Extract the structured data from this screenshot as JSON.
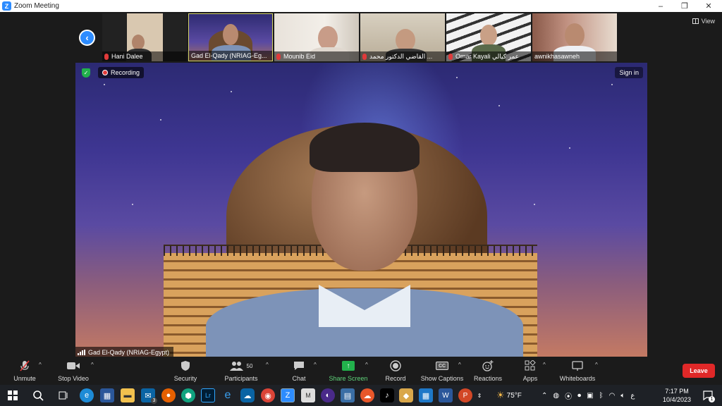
{
  "window": {
    "title": "Zoom Meeting",
    "minimize": "–",
    "restore": "❐",
    "close": "✕"
  },
  "meeting": {
    "view_label": "View",
    "nav_prev": "‹",
    "participants_strip": [
      {
        "name": "Hani Dalee",
        "muted": true
      },
      {
        "name": "Gad El-Qady (NRIAG-Eg...",
        "muted": false
      },
      {
        "name": "Mounib Eid",
        "muted": true
      },
      {
        "name": "القاضي الدكتور محمد ...",
        "muted": true
      },
      {
        "name": "Omar Kayali  عمر كيالي",
        "muted": true
      },
      {
        "name": "awnikhasawneh",
        "muted": false
      }
    ],
    "recording_label": "Recording",
    "signin_label": "Sign in",
    "active_speaker_name": "Gad El-Qady (NRIAG-Egypt)",
    "security_check": "✓"
  },
  "toolbar": {
    "unmute": "Unmute",
    "stop_video": "Stop Video",
    "security": "Security",
    "participants": "Participants",
    "participants_count": "50",
    "chat": "Chat",
    "share_screen": "Share Screen",
    "record": "Record",
    "show_captions": "Show Captions",
    "cc": "CC",
    "reactions": "Reactions",
    "apps": "Apps",
    "whiteboards": "Whiteboards",
    "leave": "Leave",
    "caret": "^"
  },
  "taskbar": {
    "weather": "75°F",
    "time": "7:17 PM",
    "date": "10/4/2023",
    "lang": "ع",
    "mail_badge": "3",
    "notif_count": "1"
  }
}
